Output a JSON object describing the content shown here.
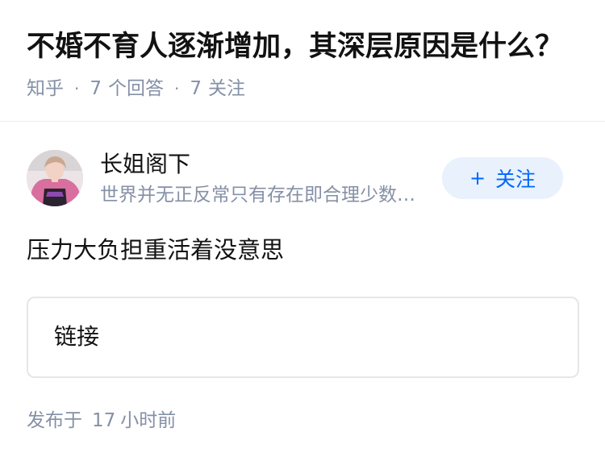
{
  "question": {
    "title": "不婚不育人逐渐增加，其深层原因是什么？",
    "source": "知乎",
    "answer_count": "7",
    "answer_label": "个回答",
    "follower_count": "7",
    "follower_label": "关注"
  },
  "author": {
    "name": "长姐阁下",
    "bio": "世界并无正反常只有存在即合理少数派和多数派",
    "follow_button": {
      "icon": "plus-icon",
      "label": "关注"
    }
  },
  "answer": {
    "text": "压力大负担重活着没意思",
    "link_card_label": "链接"
  },
  "publish": {
    "prefix": "发布于",
    "time_value": "17",
    "time_unit": "小时前"
  },
  "colors": {
    "primary_text": "#121212",
    "secondary_text": "#8590a6",
    "accent_blue": "#0066ff",
    "follow_button_bg": "#e8f1fc",
    "divider": "#ebebeb"
  }
}
